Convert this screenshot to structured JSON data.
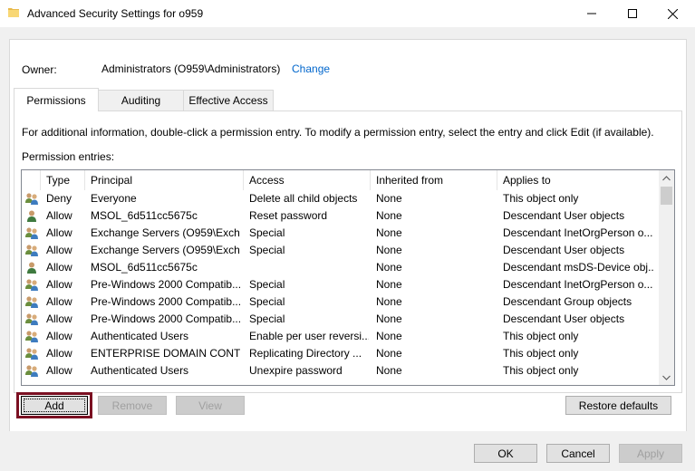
{
  "window": {
    "title": "Advanced Security Settings for o959",
    "minimize_glyph": "—",
    "maximize_glyph": "☐",
    "close_glyph": "✕"
  },
  "owner": {
    "label": "Owner:",
    "value": "Administrators (O959\\Administrators)",
    "change_link": "Change"
  },
  "tabs": [
    {
      "label": "Permissions",
      "active": true
    },
    {
      "label": "Auditing",
      "active": false
    },
    {
      "label": "Effective Access",
      "active": false
    }
  ],
  "info_text": "For additional information, double-click a permission entry. To modify a permission entry, select the entry and click Edit (if available).",
  "entries_label": "Permission entries:",
  "columns": [
    "Type",
    "Principal",
    "Access",
    "Inherited from",
    "Applies to"
  ],
  "entries": [
    {
      "icon": "group-icon",
      "type": "Deny",
      "principal": "Everyone",
      "access": "Delete all child objects",
      "inherited": "None",
      "applies": "This object only"
    },
    {
      "icon": "user-icon",
      "type": "Allow",
      "principal": "MSOL_6d511cc5675c",
      "access": "Reset password",
      "inherited": "None",
      "applies": "Descendant User objects"
    },
    {
      "icon": "group-icon",
      "type": "Allow",
      "principal": "Exchange Servers (O959\\Exch...",
      "access": "Special",
      "inherited": "None",
      "applies": "Descendant InetOrgPerson o..."
    },
    {
      "icon": "group-icon",
      "type": "Allow",
      "principal": "Exchange Servers (O959\\Exch...",
      "access": "Special",
      "inherited": "None",
      "applies": "Descendant User objects"
    },
    {
      "icon": "user-icon",
      "type": "Allow",
      "principal": "MSOL_6d511cc5675c",
      "access": "",
      "inherited": "None",
      "applies": "Descendant msDS-Device obj..."
    },
    {
      "icon": "group-icon",
      "type": "Allow",
      "principal": "Pre-Windows 2000 Compatib...",
      "access": "Special",
      "inherited": "None",
      "applies": "Descendant InetOrgPerson o..."
    },
    {
      "icon": "group-icon",
      "type": "Allow",
      "principal": "Pre-Windows 2000 Compatib...",
      "access": "Special",
      "inherited": "None",
      "applies": "Descendant Group objects"
    },
    {
      "icon": "group-icon",
      "type": "Allow",
      "principal": "Pre-Windows 2000 Compatib...",
      "access": "Special",
      "inherited": "None",
      "applies": "Descendant User objects"
    },
    {
      "icon": "group-icon",
      "type": "Allow",
      "principal": "Authenticated Users",
      "access": "Enable per user reversi...",
      "inherited": "None",
      "applies": "This object only"
    },
    {
      "icon": "group-icon",
      "type": "Allow",
      "principal": "ENTERPRISE DOMAIN CONT...",
      "access": "Replicating Directory ...",
      "inherited": "None",
      "applies": "This object only"
    },
    {
      "icon": "group-icon",
      "type": "Allow",
      "principal": "Authenticated Users",
      "access": "Unexpire password",
      "inherited": "None",
      "applies": "This object only"
    }
  ],
  "buttons": {
    "add": "Add",
    "remove": "Remove",
    "view": "View",
    "restore_defaults": "Restore defaults",
    "ok": "OK",
    "cancel": "Cancel",
    "apply": "Apply"
  },
  "colors": {
    "link": "#0066cc",
    "focus_ring": "#7b1022",
    "disabled_text": "#a0a0a0"
  }
}
